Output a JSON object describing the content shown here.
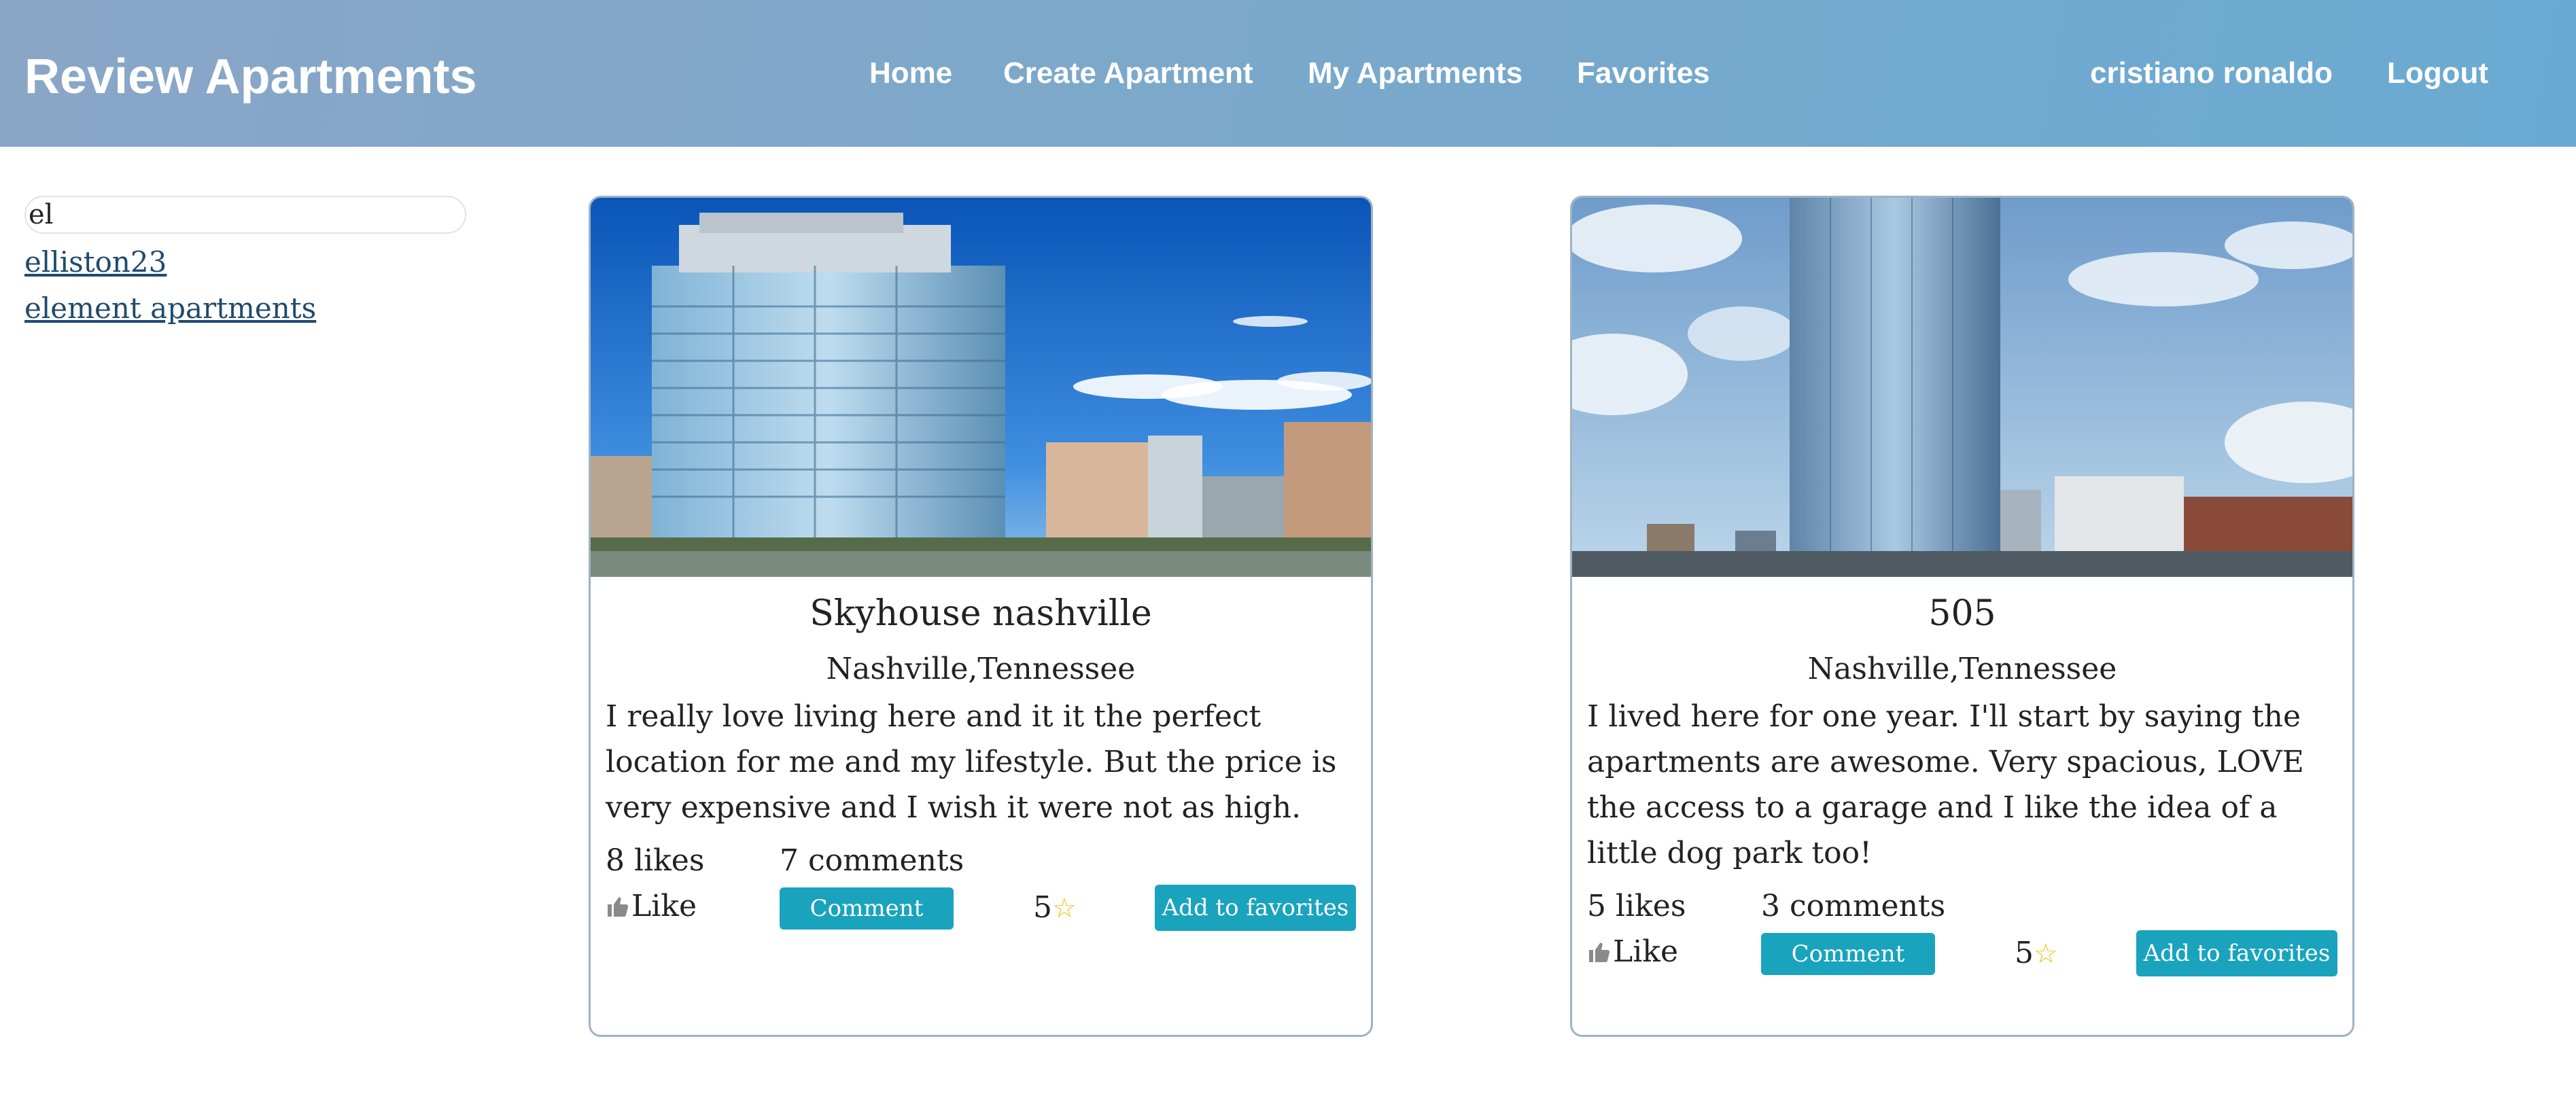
{
  "header": {
    "brand": "Review Apartments",
    "nav": {
      "home": "Home",
      "create": "Create Apartment",
      "mine": "My Apartments",
      "favorites": "Favorites"
    },
    "user": "cristiano ronaldo",
    "logout": "Logout"
  },
  "search": {
    "value": "el",
    "results": [
      "elliston23",
      "element apartments"
    ]
  },
  "cards": [
    {
      "title": "Skyhouse nashville",
      "location": "Nashville,Tennessee",
      "description": "I really love living here and it it the perfect location for me and my lifestyle. But the price is very expensive and I wish it were not as high.",
      "likes": "8 likes",
      "comments": "7 comments",
      "like_label": "Like",
      "comment_label": "Comment",
      "rating": "5",
      "favorite_label": "Add to favorites"
    },
    {
      "title": "505",
      "location": "Nashville,Tennessee",
      "description": "I lived here for one year. I'll start by saying the apartments are awesome. Very spacious, LOVE the access to a garage and I like the idea of a little dog park too!",
      "likes": "5 likes",
      "comments": "3 comments",
      "like_label": "Like",
      "comment_label": "Comment",
      "rating": "5",
      "favorite_label": "Add to favorites"
    }
  ],
  "colors": {
    "header_gradient_start": "#8aa6c7",
    "header_gradient_end": "#6aaad2",
    "button": "#1aa3bd",
    "link": "#1f4a6e",
    "star": "#f4c21b"
  },
  "icons": {
    "like": "thumbs-up-icon",
    "star": "star-icon"
  }
}
